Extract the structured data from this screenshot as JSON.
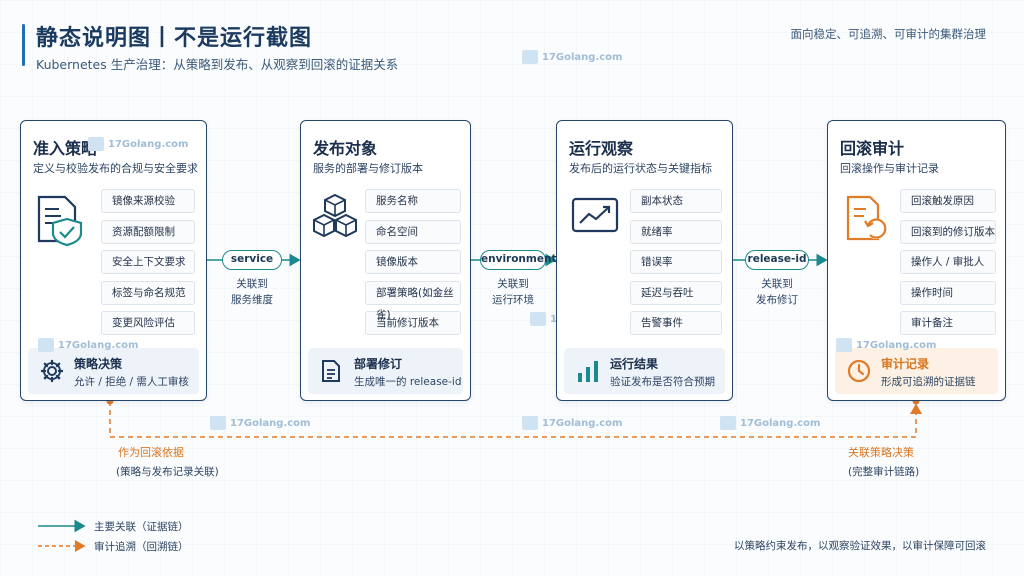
{
  "header": {
    "title": "静态说明图丨不是运行截图",
    "subtitle": "Kubernetes 生产治理：从策略到发布、从观察到回滚的证据关系",
    "right_note": "面向稳定、可追溯、可审计的集群治理"
  },
  "watermark": "17Golang.com",
  "cards": [
    {
      "title": "准入策略",
      "desc": "定义与校验发布的合规与安全要求",
      "icon": "document-shield-icon",
      "items": [
        "镜像来源校验",
        "资源配额限制",
        "安全上下文要求",
        "标签与命名规范",
        "变更风险评估"
      ],
      "footer_icon": "gear-icon",
      "footer_title": "策略决策",
      "footer_text": "允许 / 拒绝 / 需人工审核"
    },
    {
      "title": "发布对象",
      "desc": "服务的部署与修订版本",
      "icon": "cubes-icon",
      "items": [
        "服务名称",
        "命名空间",
        "镜像版本",
        "部署策略(如金丝雀)",
        "当前修订版本"
      ],
      "footer_icon": "document-icon",
      "footer_title": "部署修订",
      "footer_text": "生成唯一的 release-id"
    },
    {
      "title": "运行观察",
      "desc": "发布后的运行状态与关键指标",
      "icon": "trend-chart-icon",
      "items": [
        "副本状态",
        "就绪率",
        "错误率",
        "延迟与吞吐",
        "告警事件"
      ],
      "footer_icon": "bar-chart-icon",
      "footer_title": "运行结果",
      "footer_text": "验证发布是否符合预期"
    },
    {
      "title": "回滚审计",
      "desc": "回滚操作与审计记录",
      "icon": "document-rollback-icon",
      "items": [
        "回滚触发原因",
        "回滚到的修订版本",
        "操作人 / 审批人",
        "操作时间",
        "审计备注"
      ],
      "footer_icon": "clock-icon",
      "footer_title": "审计记录",
      "footer_text": "形成可追溯的证据链"
    }
  ],
  "connectors": [
    {
      "pill": "service",
      "label_line1": "关联到",
      "label_line2": "服务维度"
    },
    {
      "pill": "environment",
      "label_line1": "关联到",
      "label_line2": "运行环境"
    },
    {
      "pill": "release-id",
      "label_line1": "关联到",
      "label_line2": "发布修订"
    }
  ],
  "trace": {
    "left_title": "作为回滚依据",
    "left_sub": "(策略与发布记录关联)",
    "right_title": "关联策略决策",
    "right_sub": "(完整审计链路)"
  },
  "legend": {
    "primary": "主要关联（证据链）",
    "secondary": "审计追溯（回溯链）"
  },
  "footer_note": "以策略约束发布，以观察验证效果，以审计保障可回滚",
  "colors": {
    "primary_line": "#1b8a8c",
    "trace_line": "#e07b27",
    "card_border": "#26466b",
    "icon_blue": "#1f3a5c",
    "icon_orange": "#e07b27"
  }
}
